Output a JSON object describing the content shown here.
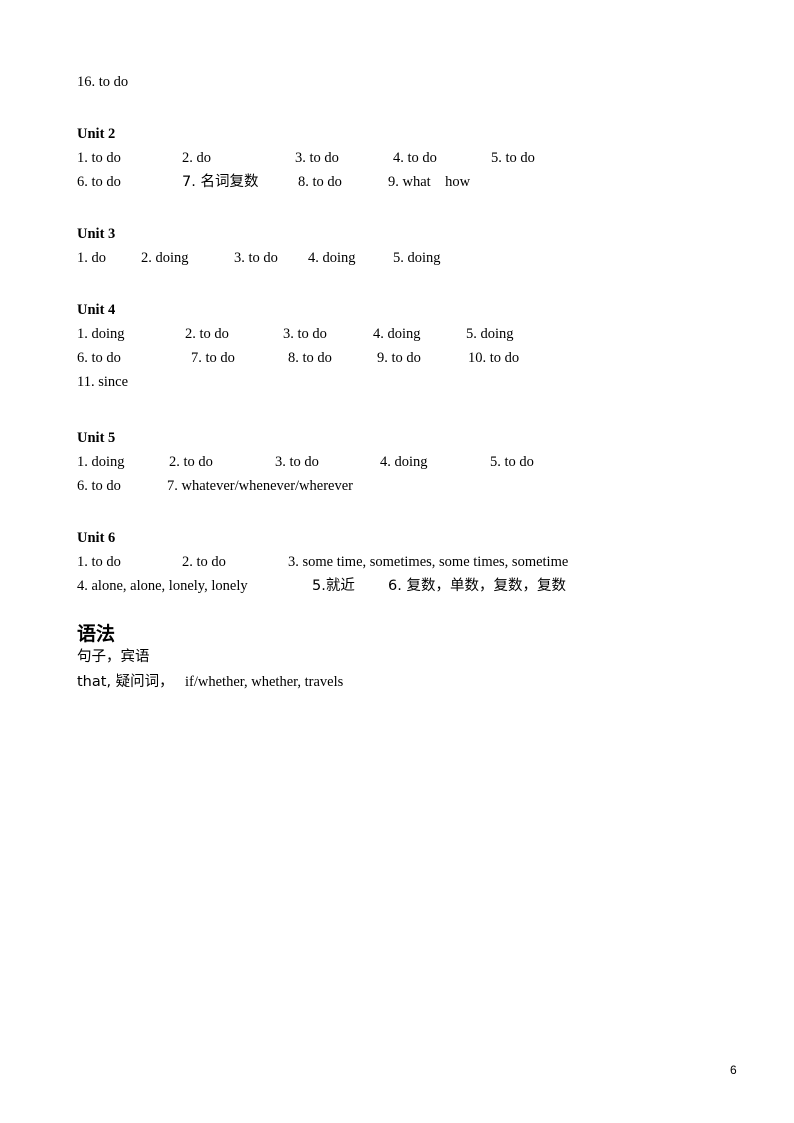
{
  "top": {
    "item": "16. to do"
  },
  "unit2": {
    "title": "Unit 2",
    "row1": [
      "1. to do",
      "2. do",
      "3. to do",
      "4. to do",
      "5. to do"
    ],
    "row2": [
      "6. to do",
      "7. 名词复数",
      "8. to do",
      "9. what    how"
    ]
  },
  "unit3": {
    "title": "Unit 3",
    "row1": [
      "1. do",
      "2. doing",
      "3. to do",
      "4. doing",
      "5. doing"
    ]
  },
  "unit4": {
    "title": "Unit 4",
    "row1": [
      "1. doing",
      "2. to do",
      "3. to do",
      "4. doing",
      "5. doing"
    ],
    "row2": [
      "6. to do",
      "7. to do",
      "8. to do",
      "9. to do",
      "10. to do"
    ],
    "row3": [
      "11. since"
    ]
  },
  "unit5": {
    "title": "Unit 5",
    "row1": [
      "1. doing",
      "2. to do",
      "3. to do",
      "4. doing",
      "5. to do"
    ],
    "row2": [
      "6. to do",
      "7. whatever/whenever/wherever"
    ]
  },
  "unit6": {
    "title": "Unit 6",
    "row1": [
      "1. to do",
      "2. to do",
      "3. some time, sometimes, some times, sometime"
    ],
    "row2": [
      "4. alone, alone, lonely, lonely",
      "5.就近",
      "6. 复数，单数，复数，复数"
    ]
  },
  "grammar": {
    "title": "语法",
    "line1": "句子，宾语",
    "line2a": "that, 疑问词，",
    "line2b": "if/whether, whether, travels"
  },
  "page_number": "6"
}
